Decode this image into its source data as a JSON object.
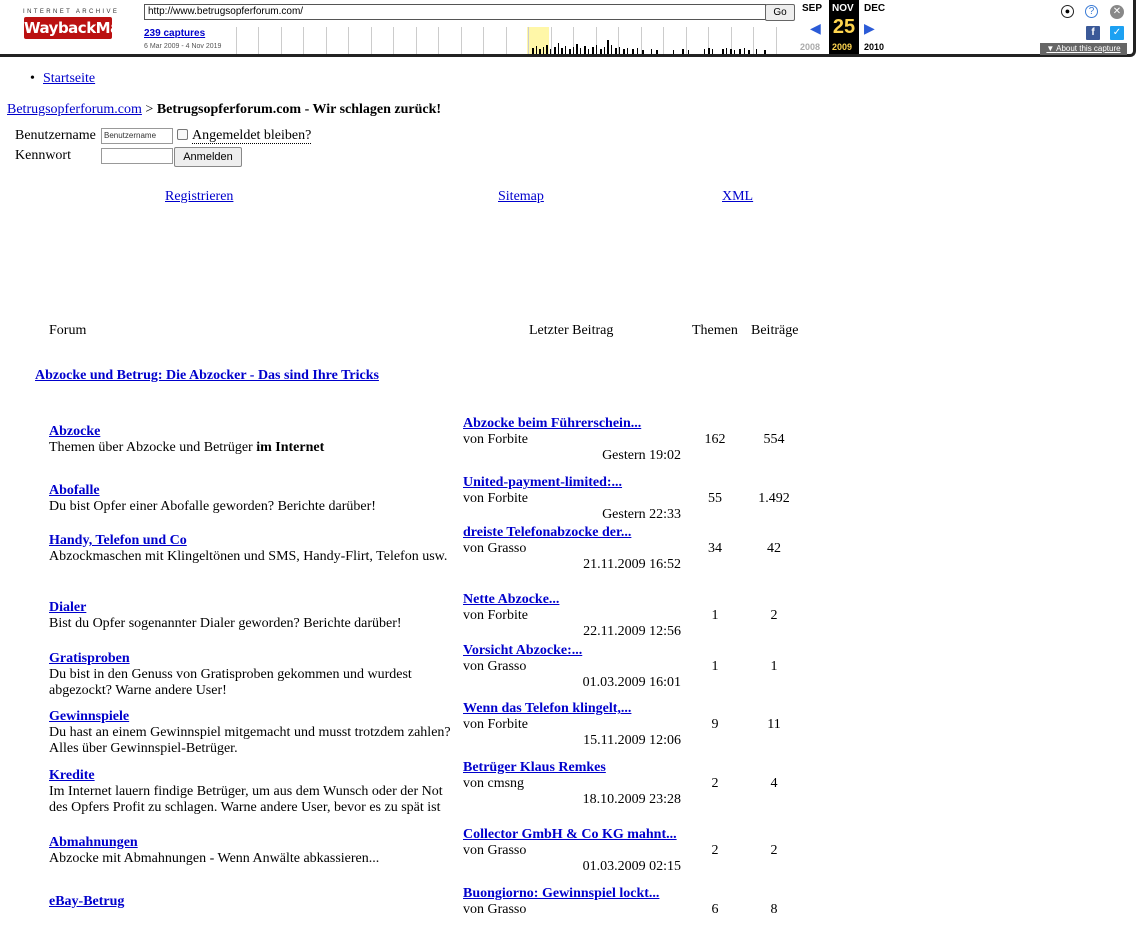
{
  "wayback": {
    "logo_top": "INTERNET ARCHIVE",
    "logo_main": "WaybackMachine",
    "url": "http://www.betrugsopferforum.com/",
    "go_label": "Go",
    "captures": "239 captures",
    "range": "6 Mar 2009 - 4 Nov 2019",
    "prev_month": "SEP",
    "cur_month": "NOV",
    "next_month": "DEC",
    "day": "25",
    "prev_year": "2008",
    "cur_year": "2009",
    "next_year": "2010",
    "about": "About this capture",
    "accent": "#2b5bd7",
    "brand": "#b11111"
  },
  "nav": {
    "startseite": "Startseite"
  },
  "breadcrumb": {
    "home": "Betrugsopferforum.com",
    "separator": ">",
    "current": "Betrugsopferforum.com - Wir schlagen zurück!"
  },
  "login": {
    "username_label": "Benutzername",
    "username_value": "Benutzername",
    "remember_label": "Angemeldet bleiben?",
    "password_label": "Kennwort",
    "submit_label": "Anmelden"
  },
  "links": {
    "register": "Registrieren",
    "sitemap": "Sitemap",
    "xml": "XML"
  },
  "table_headers": {
    "forum": "Forum",
    "last_post": "Letzter Beitrag",
    "threads": "Themen",
    "posts": "Beiträge"
  },
  "category": "Abzocke und Betrug: Die Abzocker - Das sind Ihre Tricks",
  "forums": [
    {
      "name": "Abzocke",
      "desc_pre": "Themen über Abzocke und Betrüger ",
      "desc_bold": "im Internet",
      "last_title": "Abzocke beim Führerschein...",
      "last_by": "von Forbite",
      "last_date": "Gestern 19:02",
      "threads": "162",
      "posts": "554"
    },
    {
      "name": "Abofalle",
      "desc_pre": "Du bist Opfer einer Abofalle geworden? Berichte darüber!",
      "desc_bold": "",
      "last_title": "United-payment-limited:...",
      "last_by": "von Forbite",
      "last_date": "Gestern 22:33",
      "threads": "55",
      "posts": "1.492"
    },
    {
      "name": "Handy, Telefon und Co",
      "desc_pre": "Abzockmaschen mit Klingeltönen und SMS, Handy-Flirt, Telefon usw.",
      "desc_bold": "",
      "last_title": "dreiste Telefonabzocke der...",
      "last_by": "von Grasso",
      "last_date": "21.11.2009 16:52",
      "threads": "34",
      "posts": "42"
    },
    {
      "name": "Dialer",
      "desc_pre": "Bist du Opfer sogenannter Dialer geworden? Berichte darüber!",
      "desc_bold": "",
      "last_title": "Nette Abzocke...",
      "last_by": "von Forbite",
      "last_date": "22.11.2009 12:56",
      "threads": "1",
      "posts": "2"
    },
    {
      "name": "Gratisproben",
      "desc_pre": "Du bist in den Genuss von Gratisproben gekommen und wurdest abgezockt? Warne andere User!",
      "desc_bold": "",
      "last_title": "Vorsicht Abzocke:...",
      "last_by": "von Grasso",
      "last_date": "01.03.2009 16:01",
      "threads": "1",
      "posts": "1"
    },
    {
      "name": "Gewinnspiele",
      "desc_pre": "Du hast an einem Gewinnspiel mitgemacht und musst trotzdem zahlen? Alles über Gewinnspiel-Betrüger.",
      "desc_bold": "",
      "last_title": "Wenn das Telefon klingelt,...",
      "last_by": "von Forbite",
      "last_date": "15.11.2009 12:06",
      "threads": "9",
      "posts": "11"
    },
    {
      "name": "Kredite",
      "desc_pre": "Im Internet lauern findige Betrüger, um aus dem Wunsch oder der Not des Opfers Profit zu schlagen. Warne andere User, bevor es zu spät ist",
      "desc_bold": "",
      "last_title": "Betrüger Klaus Remkes",
      "last_by": "von cmsng",
      "last_date": "18.10.2009 23:28",
      "threads": "2",
      "posts": "4"
    },
    {
      "name": "Abmahnungen",
      "desc_pre": "Abzocke mit Abmahnungen - Wenn Anwälte abkassieren...",
      "desc_bold": "",
      "last_title": "Collector GmbH & Co KG mahnt...",
      "last_by": "von Grasso",
      "last_date": "01.03.2009 02:15",
      "threads": "2",
      "posts": "2"
    },
    {
      "name": "eBay-Betrug",
      "desc_pre": "",
      "desc_bold": "",
      "last_title": "Buongiorno: Gewinnspiel lockt...",
      "last_by": "von Grasso",
      "last_date": "",
      "threads": "6",
      "posts": "8"
    }
  ]
}
